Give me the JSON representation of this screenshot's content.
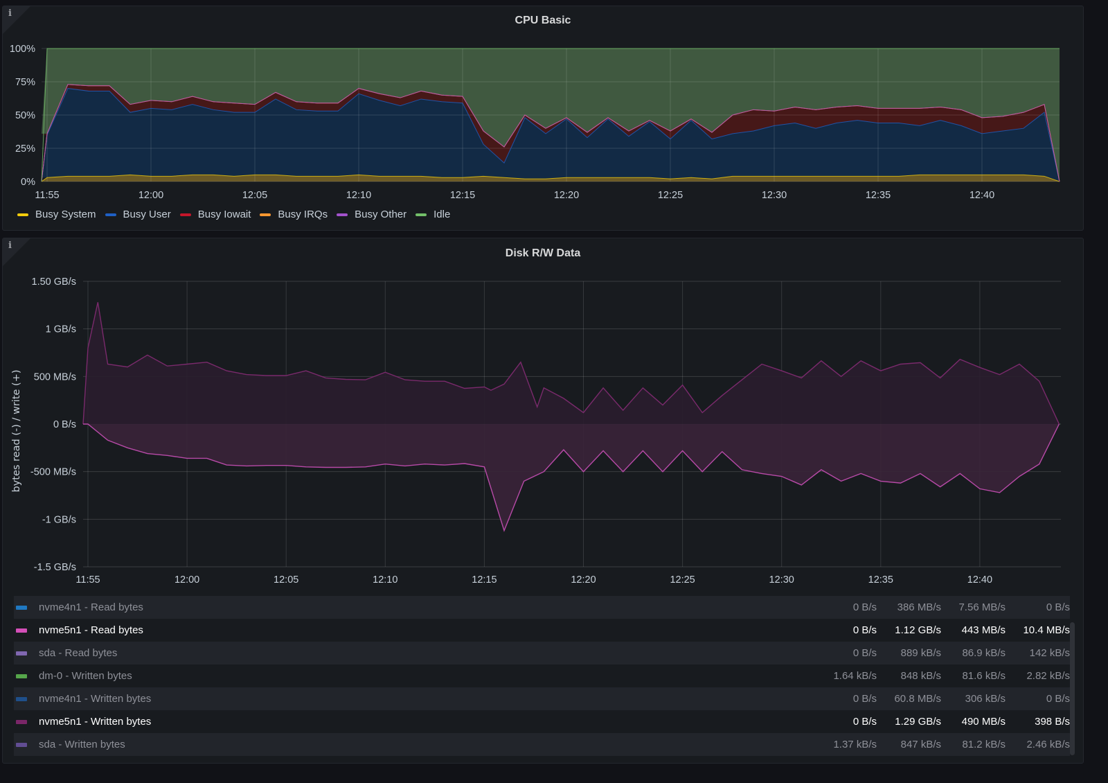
{
  "chart_data": [
    {
      "type": "area",
      "stacked": true,
      "title": "CPU Basic",
      "y_unit": "percent",
      "ylim": [
        0,
        100
      ],
      "y_ticks": [
        "0%",
        "25%",
        "50%",
        "75%",
        "100%"
      ],
      "x_ticks": [
        "11:55",
        "12:00",
        "12:05",
        "12:10",
        "12:15",
        "12:20",
        "12:25",
        "12:30",
        "12:35",
        "12:40"
      ],
      "grid": true,
      "legend_position": "bottom-left",
      "x": [
        "11:55",
        "11:56",
        "11:57",
        "11:58",
        "11:59",
        "12:00",
        "12:01",
        "12:02",
        "12:03",
        "12:04",
        "12:05",
        "12:06",
        "12:07",
        "12:08",
        "12:09",
        "12:10",
        "12:11",
        "12:12",
        "12:13",
        "12:14",
        "12:15",
        "12:16",
        "12:17",
        "12:18",
        "12:19",
        "12:20",
        "12:21",
        "12:22",
        "12:23",
        "12:24",
        "12:25",
        "12:26",
        "12:27",
        "12:28",
        "12:29",
        "12:30",
        "12:31",
        "12:32",
        "12:33",
        "12:34",
        "12:35",
        "12:36",
        "12:37",
        "12:38",
        "12:39",
        "12:40",
        "12:41",
        "12:42",
        "12:43",
        "12:44"
      ],
      "series": [
        {
          "name": "Busy System",
          "color": "#f2cc0c",
          "fill": "#6b5a26",
          "values": [
            3,
            4,
            4,
            4,
            5,
            4,
            4,
            5,
            5,
            4,
            5,
            5,
            4,
            4,
            4,
            5,
            4,
            4,
            4,
            3,
            3,
            4,
            3,
            2,
            2,
            3,
            3,
            3,
            3,
            3,
            2,
            3,
            2,
            4,
            4,
            4,
            4,
            4,
            4,
            4,
            4,
            4,
            5,
            5,
            5,
            5,
            5,
            5,
            4,
            0
          ]
        },
        {
          "name": "Busy User",
          "color": "#1f60c4",
          "fill": "#122a45",
          "values": [
            32,
            66,
            64,
            64,
            47,
            51,
            50,
            53,
            49,
            48,
            47,
            57,
            50,
            49,
            49,
            61,
            57,
            53,
            58,
            57,
            56,
            24,
            11,
            46,
            34,
            44,
            30,
            44,
            31,
            42,
            30,
            43,
            30,
            32,
            34,
            38,
            40,
            36,
            40,
            42,
            40,
            40,
            37,
            41,
            37,
            31,
            33,
            35,
            48,
            0
          ]
        },
        {
          "name": "Busy Iowait",
          "color": "#c4162a",
          "fill": "#461818",
          "values": [
            1,
            3,
            4,
            4,
            6,
            6,
            6,
            6,
            6,
            7,
            6,
            5,
            6,
            6,
            6,
            4,
            5,
            6,
            6,
            5,
            5,
            10,
            12,
            2,
            4,
            1,
            4,
            1,
            4,
            1,
            6,
            1,
            5,
            14,
            16,
            11,
            12,
            14,
            12,
            11,
            11,
            11,
            13,
            10,
            12,
            12,
            11,
            12,
            6,
            0
          ]
        },
        {
          "name": "Busy IRQs",
          "color": "#ff9830",
          "fill": "#5a3a1a",
          "values": [
            0,
            0,
            0,
            0,
            0,
            0,
            0,
            0,
            0,
            0,
            0,
            0,
            0,
            0,
            0,
            0,
            0,
            0,
            0,
            0,
            0,
            0,
            0,
            0,
            0,
            0,
            0,
            0,
            0,
            0,
            0,
            0,
            0,
            0,
            0,
            0,
            0,
            0,
            0,
            0,
            0,
            0,
            0,
            0,
            0,
            0,
            0,
            0,
            0,
            0
          ]
        },
        {
          "name": "Busy Other",
          "color": "#a352cc",
          "fill": "#3a1f45",
          "values": [
            0,
            0,
            0,
            0,
            0,
            0,
            0,
            0,
            0,
            0,
            0,
            0,
            0,
            0,
            0,
            0,
            0,
            0,
            0,
            0,
            0,
            0,
            0,
            0,
            0,
            0,
            0,
            0,
            0,
            0,
            0,
            0,
            0,
            0,
            0,
            0,
            0,
            0,
            0,
            0,
            0,
            0,
            0,
            0,
            0,
            0,
            0,
            0,
            0,
            0
          ]
        },
        {
          "name": "Idle",
          "color": "#73bf69",
          "fill": "#405940",
          "values": [
            64,
            27,
            28,
            28,
            42,
            39,
            40,
            36,
            40,
            41,
            42,
            33,
            40,
            41,
            41,
            30,
            34,
            37,
            32,
            35,
            36,
            62,
            74,
            50,
            60,
            52,
            63,
            52,
            62,
            54,
            62,
            53,
            63,
            50,
            46,
            47,
            44,
            46,
            44,
            43,
            45,
            45,
            45,
            44,
            46,
            52,
            51,
            48,
            42,
            100
          ]
        }
      ]
    },
    {
      "type": "area",
      "title": "Disk R/W Data",
      "ylabel": "bytes read (-) / write (+)",
      "y_unit": "MB/s",
      "ylim": [
        -1500,
        1500
      ],
      "y_ticks": [
        {
          "value": 1500,
          "label": "1.50 GB/s"
        },
        {
          "value": 1000,
          "label": "1 GB/s"
        },
        {
          "value": 500,
          "label": "500 MB/s"
        },
        {
          "value": 0,
          "label": "0 B/s"
        },
        {
          "value": -500,
          "label": "-500 MB/s"
        },
        {
          "value": -1000,
          "label": "-1 GB/s"
        },
        {
          "value": -1500,
          "label": "-1.5 GB/s"
        }
      ],
      "x_ticks": [
        "11:55",
        "12:00",
        "12:05",
        "12:10",
        "12:15",
        "12:20",
        "12:25",
        "12:30",
        "12:35",
        "12:40"
      ],
      "grid": true,
      "legend_position": "bottom",
      "series": [
        {
          "name": "nvme5n1 - Written bytes",
          "color": "#7a2a6c",
          "fill": "#2a1d2e",
          "points": [
            [
              "11:54:45",
              0
            ],
            [
              "11:55",
              800
            ],
            [
              "11:55:30",
              1280
            ],
            [
              "11:56",
              630
            ],
            [
              "11:57",
              600
            ],
            [
              "11:58",
              725
            ],
            [
              "11:59",
              610
            ],
            [
              "12:00",
              630
            ],
            [
              "12:01",
              650
            ],
            [
              "12:02",
              560
            ],
            [
              "12:03",
              520
            ],
            [
              "12:04",
              510
            ],
            [
              "12:05",
              510
            ],
            [
              "12:06",
              560
            ],
            [
              "12:07",
              485
            ],
            [
              "12:08",
              470
            ],
            [
              "12:09",
              465
            ],
            [
              "12:10",
              545
            ],
            [
              "12:11",
              465
            ],
            [
              "12:12",
              450
            ],
            [
              "12:13",
              450
            ],
            [
              "12:14",
              375
            ],
            [
              "12:15",
              390
            ],
            [
              "12:15:20",
              355
            ],
            [
              "12:16",
              420
            ],
            [
              "12:16:50",
              650
            ],
            [
              "12:17:40",
              180
            ],
            [
              "12:18",
              380
            ],
            [
              "12:19",
              270
            ],
            [
              "12:20",
              120
            ],
            [
              "12:21",
              380
            ],
            [
              "12:22",
              145
            ],
            [
              "12:23",
              380
            ],
            [
              "12:24",
              200
            ],
            [
              "12:25",
              410
            ],
            [
              "12:26",
              120
            ],
            [
              "12:27",
              300
            ],
            [
              "12:28",
              465
            ],
            [
              "12:29",
              630
            ],
            [
              "12:30",
              560
            ],
            [
              "12:31",
              485
            ],
            [
              "12:32",
              665
            ],
            [
              "12:33",
              500
            ],
            [
              "12:34",
              665
            ],
            [
              "12:35",
              560
            ],
            [
              "12:36",
              630
            ],
            [
              "12:37",
              645
            ],
            [
              "12:38",
              485
            ],
            [
              "12:39",
              680
            ],
            [
              "12:40",
              595
            ],
            [
              "12:41",
              520
            ],
            [
              "12:42",
              630
            ],
            [
              "12:43",
              450
            ],
            [
              "12:44",
              0
            ]
          ]
        },
        {
          "name": "nvme5n1 - Read bytes",
          "color": "#b84aa8",
          "fill": "#3a2439",
          "points": [
            [
              "11:54:45",
              0
            ],
            [
              "11:55",
              0
            ],
            [
              "11:56",
              -170
            ],
            [
              "11:57",
              -250
            ],
            [
              "11:58",
              -310
            ],
            [
              "11:59",
              -330
            ],
            [
              "12:00",
              -360
            ],
            [
              "12:01",
              -360
            ],
            [
              "12:02",
              -430
            ],
            [
              "12:03",
              -440
            ],
            [
              "12:04",
              -435
            ],
            [
              "12:05",
              -435
            ],
            [
              "12:06",
              -450
            ],
            [
              "12:07",
              -455
            ],
            [
              "12:08",
              -455
            ],
            [
              "12:09",
              -450
            ],
            [
              "12:10",
              -420
            ],
            [
              "12:11",
              -440
            ],
            [
              "12:12",
              -420
            ],
            [
              "12:13",
              -430
            ],
            [
              "12:14",
              -415
            ],
            [
              "12:15",
              -450
            ],
            [
              "12:16",
              -1120
            ],
            [
              "12:17",
              -600
            ],
            [
              "12:18",
              -500
            ],
            [
              "12:19",
              -270
            ],
            [
              "12:20",
              -500
            ],
            [
              "12:21",
              -280
            ],
            [
              "12:22",
              -500
            ],
            [
              "12:23",
              -280
            ],
            [
              "12:24",
              -500
            ],
            [
              "12:25",
              -280
            ],
            [
              "12:26",
              -500
            ],
            [
              "12:27",
              -290
            ],
            [
              "12:28",
              -480
            ],
            [
              "12:29",
              -520
            ],
            [
              "12:30",
              -550
            ],
            [
              "12:31",
              -640
            ],
            [
              "12:32",
              -480
            ],
            [
              "12:33",
              -600
            ],
            [
              "12:34",
              -520
            ],
            [
              "12:35",
              -600
            ],
            [
              "12:36",
              -620
            ],
            [
              "12:37",
              -520
            ],
            [
              "12:38",
              -660
            ],
            [
              "12:39",
              -520
            ],
            [
              "12:40",
              -680
            ],
            [
              "12:41",
              -720
            ],
            [
              "12:42",
              -550
            ],
            [
              "12:43",
              -420
            ],
            [
              "12:44",
              0
            ]
          ]
        }
      ],
      "legend_table": [
        {
          "name": "nvme4n1 - Read bytes",
          "color": "#1f78c1",
          "highlighted": false,
          "values": [
            "0 B/s",
            "386 MB/s",
            "7.56 MB/s",
            "0 B/s"
          ]
        },
        {
          "name": "nvme5n1 - Read bytes",
          "color": "#d44fb8",
          "highlighted": true,
          "values": [
            "0 B/s",
            "1.12 GB/s",
            "443 MB/s",
            "10.4 MB/s"
          ]
        },
        {
          "name": "sda - Read bytes",
          "color": "#8067b0",
          "highlighted": false,
          "values": [
            "0 B/s",
            "889 kB/s",
            "86.9 kB/s",
            "142 kB/s"
          ]
        },
        {
          "name": "dm-0 - Written bytes",
          "color": "#56a64b",
          "highlighted": false,
          "values": [
            "1.64 kB/s",
            "848 kB/s",
            "81.6 kB/s",
            "2.82 kB/s"
          ]
        },
        {
          "name": "nvme4n1 - Written bytes",
          "color": "#1f4f8a",
          "highlighted": false,
          "values": [
            "0 B/s",
            "60.8 MB/s",
            "306 kB/s",
            "0 B/s"
          ]
        },
        {
          "name": "nvme5n1 - Written bytes",
          "color": "#7a2668",
          "highlighted": true,
          "values": [
            "0 B/s",
            "1.29 GB/s",
            "490 MB/s",
            "398 B/s"
          ]
        },
        {
          "name": "sda - Written bytes",
          "color": "#614d93",
          "highlighted": false,
          "values": [
            "1.37 kB/s",
            "847 kB/s",
            "81.2 kB/s",
            "2.46 kB/s"
          ]
        }
      ]
    }
  ],
  "panels": {
    "cpu": {
      "title": "CPU Basic",
      "info_icon": "info-icon"
    },
    "disk": {
      "title": "Disk R/W Data",
      "info_icon": "info-icon"
    }
  }
}
